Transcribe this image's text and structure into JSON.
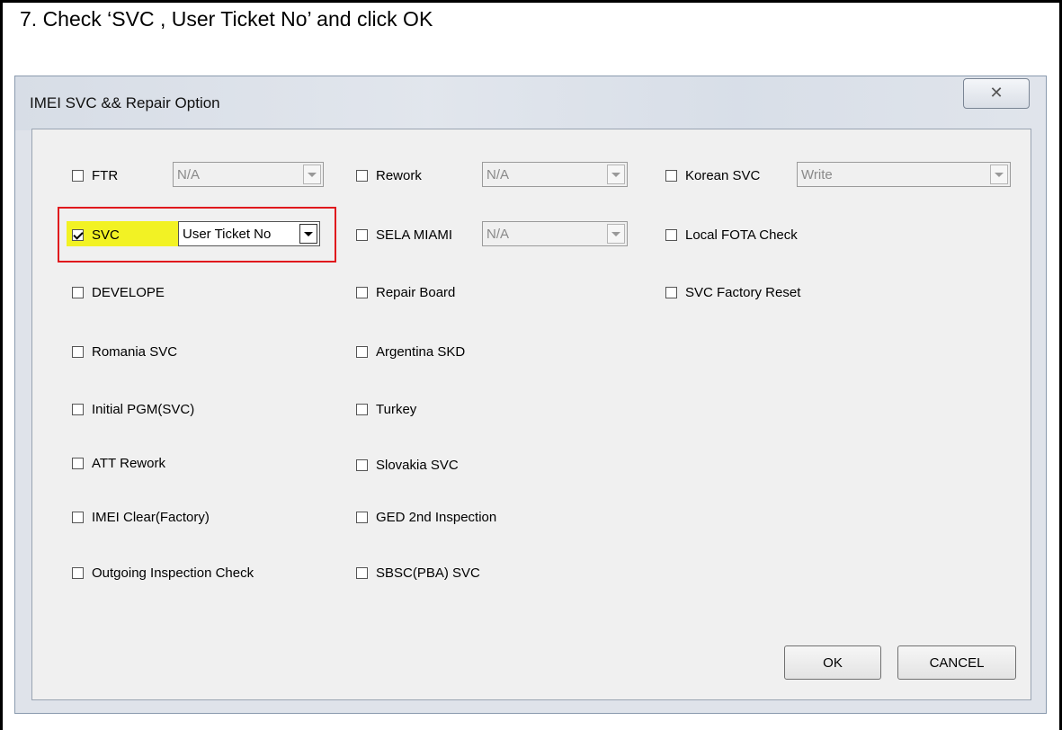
{
  "instruction": "7. Check ‘SVC , User Ticket No’ and click OK",
  "dialog": {
    "title": "IMEI SVC && Repair Option",
    "close_icon": "close-icon",
    "options": {
      "ftr": {
        "label": "FTR",
        "checked": false,
        "combo": "N/A"
      },
      "rework": {
        "label": "Rework",
        "checked": false,
        "combo": "N/A"
      },
      "korean_svc": {
        "label": "Korean SVC",
        "checked": false,
        "combo": "Write"
      },
      "svc": {
        "label": "SVC",
        "checked": true,
        "combo": "User Ticket No"
      },
      "sela_miami": {
        "label": "SELA MIAMI",
        "checked": false,
        "combo": "N/A"
      },
      "local_fota_check": {
        "label": "Local FOTA Check",
        "checked": false
      },
      "develope": {
        "label": "DEVELOPE",
        "checked": false
      },
      "repair_board": {
        "label": "Repair Board",
        "checked": false
      },
      "svc_factory_reset": {
        "label": "SVC Factory Reset",
        "checked": false
      },
      "romania_svc": {
        "label": "Romania SVC",
        "checked": false
      },
      "argentina_skd": {
        "label": "Argentina SKD",
        "checked": false
      },
      "initial_pgm_svc": {
        "label": "Initial PGM(SVC)",
        "checked": false
      },
      "turkey": {
        "label": "Turkey",
        "checked": false
      },
      "att_rework": {
        "label": "ATT Rework",
        "checked": false
      },
      "slovakia_svc": {
        "label": "Slovakia SVC",
        "checked": false
      },
      "imei_clear_factory": {
        "label": "IMEI Clear(Factory)",
        "checked": false
      },
      "ged_2nd_inspection": {
        "label": "GED 2nd Inspection",
        "checked": false
      },
      "outgoing_inspection_check": {
        "label": "Outgoing Inspection Check",
        "checked": false
      },
      "sbsc_pba_svc": {
        "label": "SBSC(PBA) SVC",
        "checked": false
      }
    },
    "buttons": {
      "ok": "OK",
      "cancel": "CANCEL"
    }
  },
  "colors": {
    "highlight": "#f2f200",
    "annotation_box": "#e0191d"
  }
}
